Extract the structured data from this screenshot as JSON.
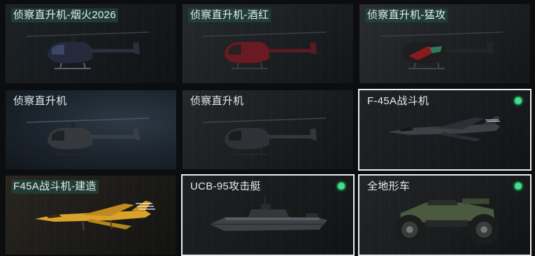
{
  "colors": {
    "selected_border": "#e9eef0",
    "status_on": "#3ee28a",
    "label_highlight_bg": "#20463c"
  },
  "vehicles": [
    {
      "label": "侦察直升机-烟火2026",
      "selected": false,
      "status": null,
      "icon": "helicopter-icon"
    },
    {
      "label": "侦察直升机-酒红",
      "selected": false,
      "status": null,
      "icon": "helicopter-icon"
    },
    {
      "label": "侦察直升机-猛攻",
      "selected": false,
      "status": null,
      "icon": "helicopter-icon"
    },
    {
      "label": "侦察直升机",
      "selected": false,
      "status": null,
      "icon": "helicopter-icon"
    },
    {
      "label": "侦察直升机",
      "selected": false,
      "status": null,
      "icon": "helicopter-icon"
    },
    {
      "label": "F-45A战斗机",
      "selected": true,
      "status": "active",
      "icon": "fighter-jet-icon"
    },
    {
      "label": "F45A战斗机-建造",
      "selected": false,
      "status": null,
      "icon": "fighter-jet-icon"
    },
    {
      "label": "UCB-95攻击艇",
      "selected": true,
      "status": "active",
      "icon": "attack-boat-icon"
    },
    {
      "label": "全地形车",
      "selected": true,
      "status": "active",
      "icon": "atv-icon"
    }
  ]
}
